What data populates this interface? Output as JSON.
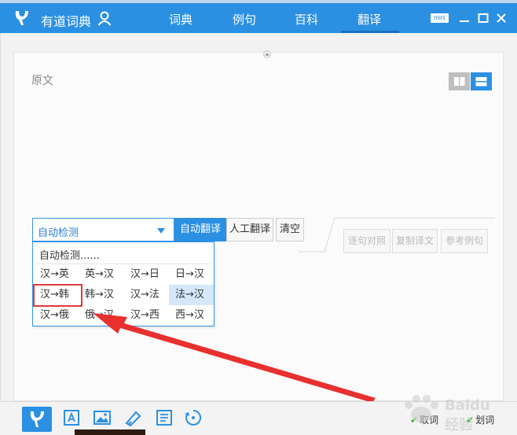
{
  "titlebar": {
    "app_title": "有道词典",
    "nav": [
      "词典",
      "例句",
      "百科",
      "翻译"
    ],
    "active_nav": "翻译",
    "mini_label": "mini",
    "accent": "#2b90e2"
  },
  "source": {
    "label": "原文"
  },
  "toolbar": {
    "lang_select_value": "自动检测",
    "auto_translate": "自动翻译",
    "human_translate": "人工翻译",
    "clear": "清空"
  },
  "output_toolbar": {
    "sentence_align": "逐句对照",
    "copy_translation": "复制译文",
    "ref_examples": "参考例句"
  },
  "dropdown": {
    "auto": "自动检测......",
    "options": [
      [
        "汉→英",
        "英→汉",
        "汉→日",
        "日→汉"
      ],
      [
        "汉→韩",
        "韩→汉",
        "汉→法",
        "法→汉"
      ],
      [
        "汉→俄",
        "俄→汉",
        "汉→西",
        "西→汉"
      ]
    ],
    "highlighted": "法→汉",
    "annotated": "汉→韩"
  },
  "bottom": {
    "capture_label": "取词",
    "select_label": "划词",
    "watermark": "Baidu 经验",
    "icons": [
      "youdao-logo-icon",
      "ocr-icon",
      "image-icon",
      "draw-icon",
      "translate-icon",
      "sync-icon"
    ]
  }
}
